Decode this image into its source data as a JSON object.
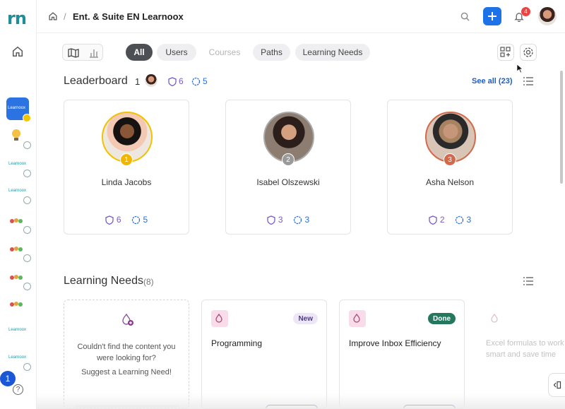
{
  "rail": {
    "logo_text": "rn",
    "app_labels": [
      "Learnoox",
      "Learnoox",
      "Learnoox",
      "Learnoox"
    ],
    "counter": "1",
    "help": "?"
  },
  "header": {
    "breadcrumb_title": "Ent. & Suite EN Learnoox",
    "breadcrumb_sep": "/",
    "notification_count": "4",
    "add_label": "+"
  },
  "toolbar": {
    "filters": [
      {
        "label": "All",
        "state": "active"
      },
      {
        "label": "Users",
        "state": "normal"
      },
      {
        "label": "Courses",
        "state": "disabled"
      },
      {
        "label": "Paths",
        "state": "normal"
      },
      {
        "label": "Learning Needs",
        "state": "normal"
      }
    ]
  },
  "leaderboard": {
    "title": "Leaderboard",
    "my_rank": "1",
    "my_shields": "6",
    "my_badges": "5",
    "see_all": "See all (23)",
    "cards": [
      {
        "rank": "1",
        "name": "Linda Jacobs",
        "shields": "6",
        "badges": "5"
      },
      {
        "rank": "2",
        "name": "Isabel Olszewski",
        "shields": "3",
        "badges": "3"
      },
      {
        "rank": "3",
        "name": "Asha Nelson",
        "shields": "2",
        "badges": "3"
      }
    ]
  },
  "learning_needs": {
    "title": "Learning Needs",
    "count": "(8)",
    "suggest": {
      "line1": "Couldn't find the content you were looking for?",
      "line2": "Suggest a Learning Need!"
    },
    "cards": [
      {
        "title": "Programming",
        "tag": "New"
      },
      {
        "title": "Improve Inbox Efficiency",
        "tag": "Done"
      }
    ],
    "faded_card": {
      "line1": "Excel formulas to work",
      "line2": "smart and save time"
    }
  },
  "colors": {
    "accent": "#1d72e8",
    "shield": "#7a5bc4",
    "badge": "#2a6fd6",
    "done": "#25775e",
    "active_pill": "#4c4f54"
  }
}
